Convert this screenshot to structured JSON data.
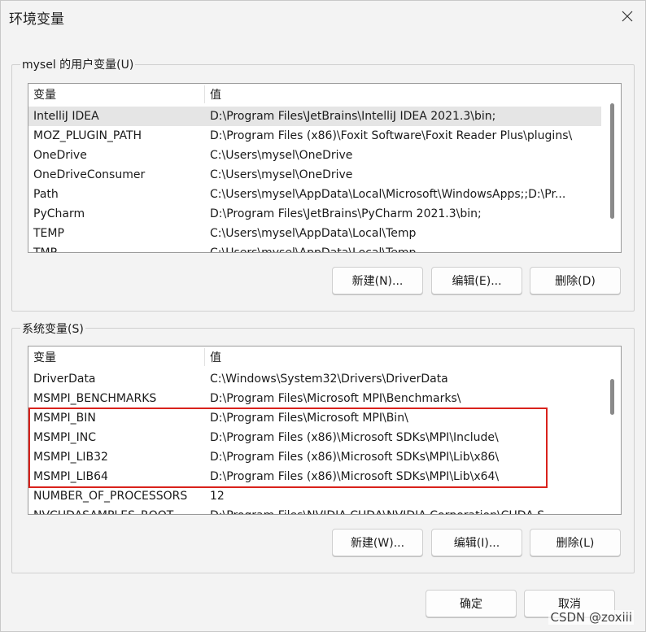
{
  "window": {
    "title": "环境变量"
  },
  "user_section": {
    "label": "mysel 的用户变量(U)",
    "columns": [
      "变量",
      "值"
    ],
    "rows": [
      {
        "name": "IntelliJ IDEA",
        "value": "D:\\Program Files\\JetBrains\\IntelliJ IDEA 2021.3\\bin;"
      },
      {
        "name": "MOZ_PLUGIN_PATH",
        "value": "D:\\Program Files (x86)\\Foxit Software\\Foxit Reader Plus\\plugins\\"
      },
      {
        "name": "OneDrive",
        "value": "C:\\Users\\mysel\\OneDrive"
      },
      {
        "name": "OneDriveConsumer",
        "value": "C:\\Users\\mysel\\OneDrive"
      },
      {
        "name": "Path",
        "value": "C:\\Users\\mysel\\AppData\\Local\\Microsoft\\WindowsApps;;D:\\Pr..."
      },
      {
        "name": "PyCharm",
        "value": "D:\\Program Files\\JetBrains\\PyCharm 2021.3\\bin;"
      },
      {
        "name": "TEMP",
        "value": "C:\\Users\\mysel\\AppData\\Local\\Temp"
      },
      {
        "name": "TMP",
        "value": "C:\\Users\\mysel\\AppData\\Local\\Temp"
      }
    ],
    "buttons": {
      "new": "新建(N)...",
      "edit": "编辑(E)...",
      "delete": "删除(D)"
    }
  },
  "system_section": {
    "label": "系统变量(S)",
    "columns": [
      "变量",
      "值"
    ],
    "rows": [
      {
        "name": "DriverData",
        "value": "C:\\Windows\\System32\\Drivers\\DriverData"
      },
      {
        "name": "MSMPI_BENCHMARKS",
        "value": "D:\\Program Files\\Microsoft MPI\\Benchmarks\\"
      },
      {
        "name": "MSMPI_BIN",
        "value": "D:\\Program Files\\Microsoft MPI\\Bin\\"
      },
      {
        "name": "MSMPI_INC",
        "value": "D:\\Program Files (x86)\\Microsoft SDKs\\MPI\\Include\\"
      },
      {
        "name": "MSMPI_LIB32",
        "value": "D:\\Program Files (x86)\\Microsoft SDKs\\MPI\\Lib\\x86\\"
      },
      {
        "name": "MSMPI_LIB64",
        "value": "D:\\Program Files (x86)\\Microsoft SDKs\\MPI\\Lib\\x64\\"
      },
      {
        "name": "NUMBER_OF_PROCESSORS",
        "value": "12"
      },
      {
        "name": "NVCUDASAMPLES_ROOT",
        "value": "D:\\Program Files\\NVIDIA CUDA\\NVIDIA Corporation\\CUDA S..."
      }
    ],
    "buttons": {
      "new": "新建(W)...",
      "edit": "编辑(I)...",
      "delete": "删除(L)"
    }
  },
  "footer": {
    "ok": "确定",
    "cancel": "取消"
  },
  "watermark": "CSDN @zoxiii",
  "colors": {
    "highlight": "#d9221c",
    "selected_row": "#e5e5e5"
  }
}
